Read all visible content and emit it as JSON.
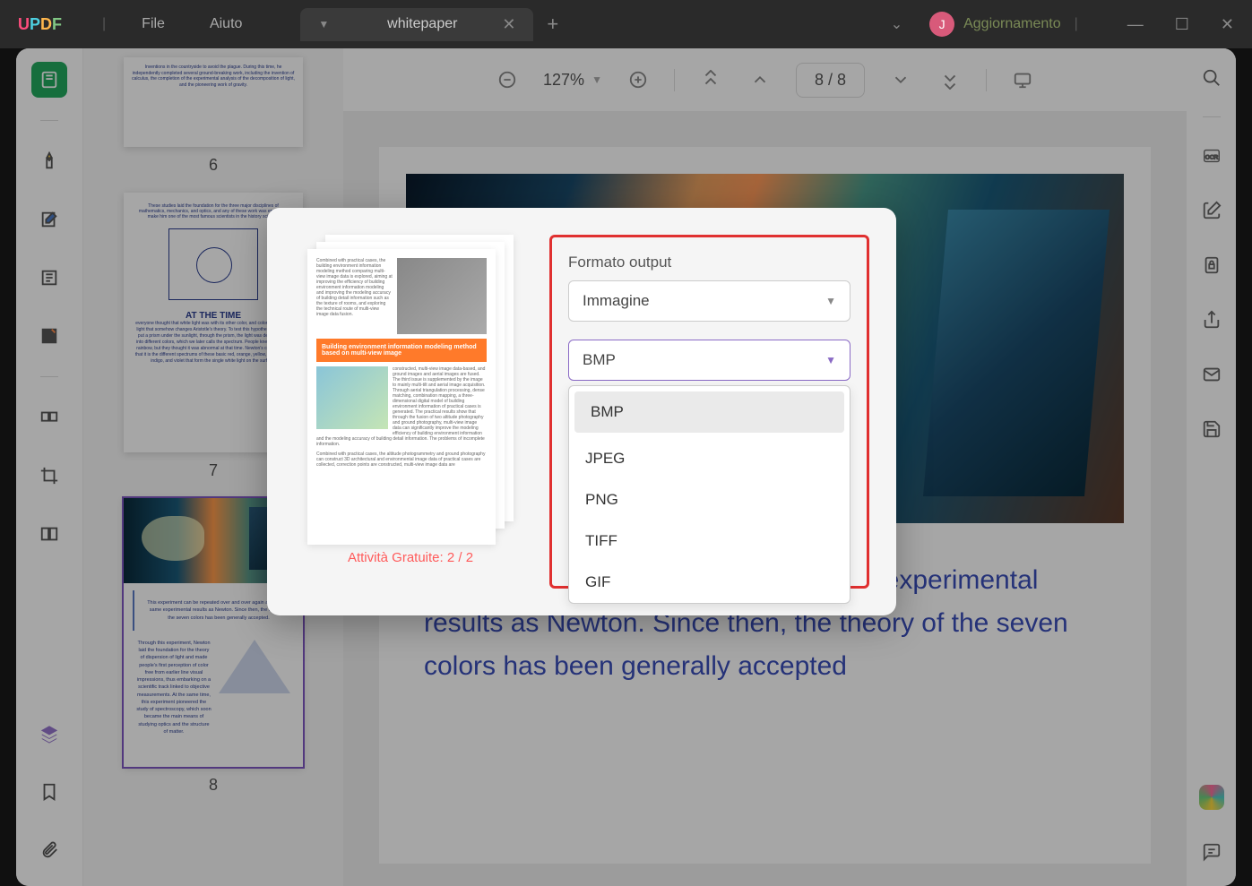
{
  "app": {
    "logo_parts": [
      "U",
      "P",
      "D",
      "F"
    ],
    "menu": {
      "file": "File",
      "help": "Aiuto"
    },
    "tab": {
      "title": "whitepaper"
    },
    "user": {
      "initial": "J",
      "update": "Aggiornamento"
    }
  },
  "toolbar": {
    "zoom": "127%",
    "page_display": "8  /  8"
  },
  "thumbnails": {
    "pages": [
      {
        "num": "6"
      },
      {
        "num": "7",
        "heading": "AT THE TIME"
      },
      {
        "num": "8"
      }
    ]
  },
  "document": {
    "body_text": "over and over again and get the same experimental results as Newton. Since then, the theory of the seven colors has been generally accepted"
  },
  "modal": {
    "output_format_label": "Formato output",
    "format_type_value": "Immagine",
    "image_format_value": "BMP",
    "dropdown_options": [
      "BMP",
      "JPEG",
      "PNG",
      "TIFF",
      "GIF"
    ],
    "preview_orange": "Building environment information modeling method based on multi-view image",
    "footer": "Attività Gratuite: 2 / 2"
  }
}
